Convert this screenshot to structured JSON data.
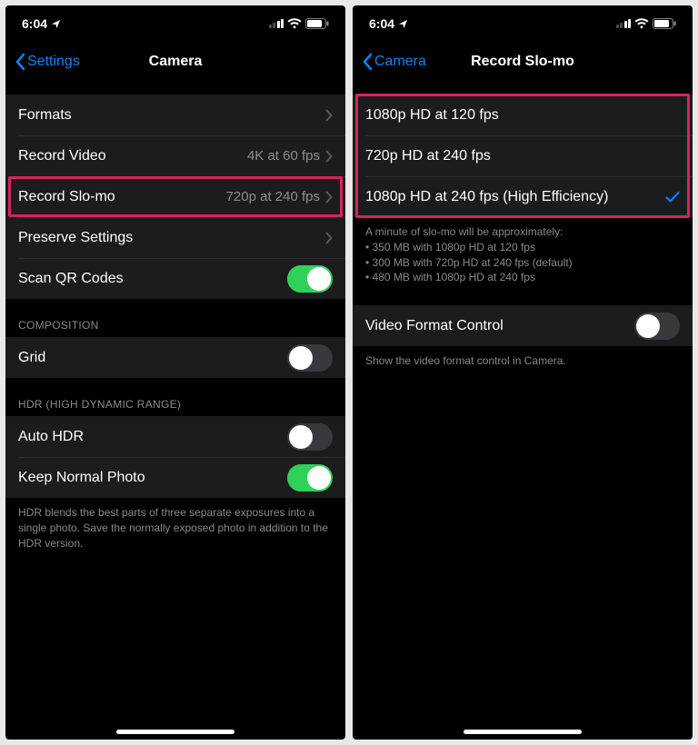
{
  "status": {
    "time": "6:04"
  },
  "left": {
    "back_label": "Settings",
    "title": "Camera",
    "rows": {
      "formats": "Formats",
      "record_video": {
        "label": "Record Video",
        "value": "4K at 60 fps"
      },
      "record_slomo": {
        "label": "Record Slo-mo",
        "value": "720p at 240 fps"
      },
      "preserve": "Preserve Settings",
      "scan_qr": "Scan QR Codes"
    },
    "composition_header": "COMPOSITION",
    "grid": "Grid",
    "hdr_header": "HDR (HIGH DYNAMIC RANGE)",
    "auto_hdr": "Auto HDR",
    "keep_normal": "Keep Normal Photo",
    "hdr_footer": "HDR blends the best parts of three separate exposures into a single photo. Save the normally exposed photo in addition to the HDR version."
  },
  "right": {
    "back_label": "Camera",
    "title": "Record Slo-mo",
    "options": [
      "1080p HD at 120 fps",
      "720p HD at 240 fps",
      "1080p HD at 240 fps (High Efficiency)"
    ],
    "footer_intro": "A minute of slo-mo will be approximately:",
    "footer_lines": [
      "• 350 MB with 1080p HD at 120 fps",
      "• 300 MB with 720p HD at 240 fps (default)",
      "• 480 MB with 1080p HD at 240 fps"
    ],
    "video_format": "Video Format Control",
    "vfc_footer": "Show the video format control in Camera."
  }
}
